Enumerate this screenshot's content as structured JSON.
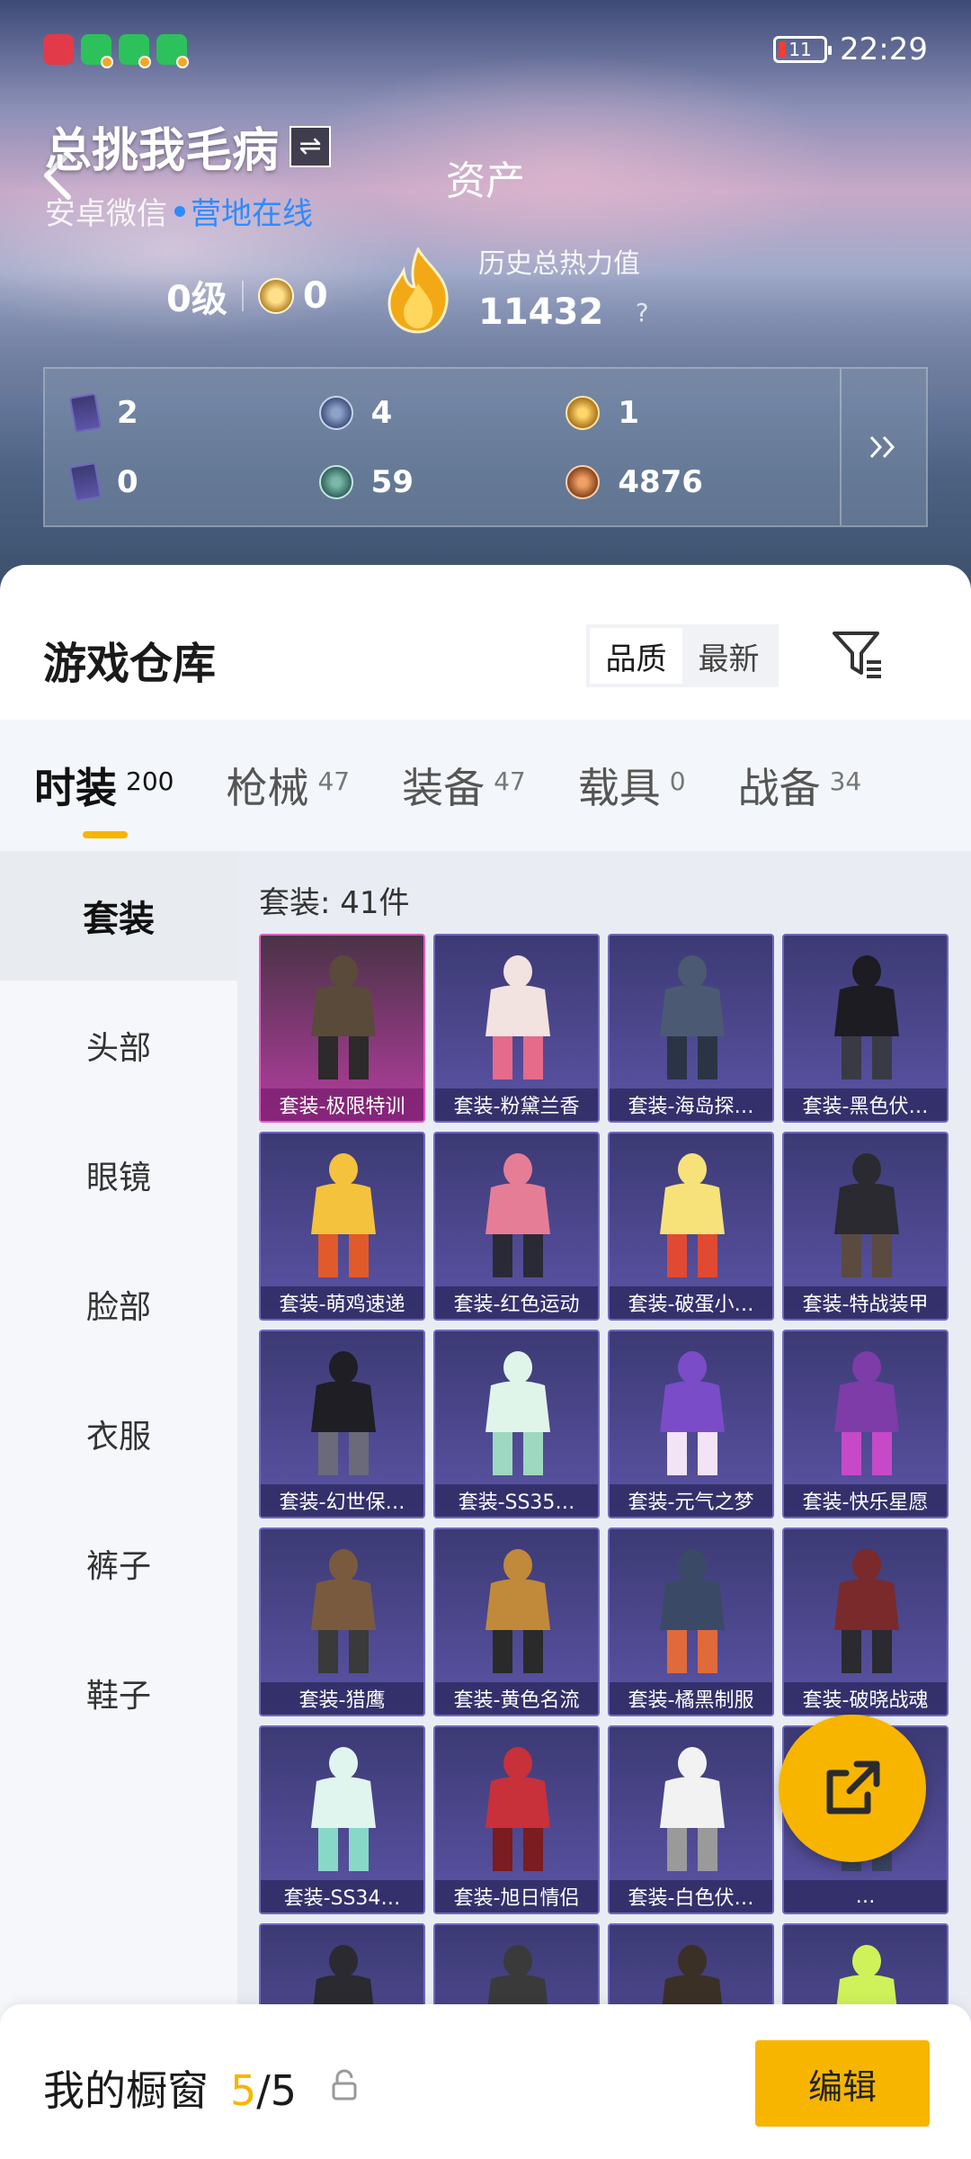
{
  "status_bar": {
    "time": "22:29",
    "battery": "11",
    "notifications": [
      "notification-app-icon",
      "wechat-icon",
      "wechat-icon",
      "wechat-icon"
    ]
  },
  "header": {
    "page_title": "资产",
    "username": "总挑我毛病",
    "platform": "安卓微信",
    "online_status": "营地在线",
    "level": "0级",
    "rank_value": "0",
    "heat_label": "历史总热力值",
    "heat_value": "11432",
    "help": "?"
  },
  "currencies": [
    {
      "icon": "card-ticket-icon",
      "value": "2"
    },
    {
      "icon": "silver-coin-icon",
      "value": "4"
    },
    {
      "icon": "gold-coin-icon",
      "value": "1"
    },
    {
      "icon": "green-card-icon",
      "value": "0"
    },
    {
      "icon": "teal-coin-icon",
      "value": "59"
    },
    {
      "icon": "copper-coin-icon",
      "value": "4876"
    }
  ],
  "warehouse": {
    "title": "游戏仓库",
    "sort_options": [
      "品质",
      "最新"
    ],
    "active_sort": "品质"
  },
  "category_tabs": [
    {
      "label": "时装",
      "count": "200",
      "active": true
    },
    {
      "label": "枪械",
      "count": "47"
    },
    {
      "label": "装备",
      "count": "47"
    },
    {
      "label": "载具",
      "count": "0"
    },
    {
      "label": "战备",
      "count": "34"
    }
  ],
  "side_menu": [
    "套装",
    "头部",
    "眼镜",
    "脸部",
    "衣服",
    "裤子",
    "鞋子"
  ],
  "set_count_label": "套装: 41件",
  "items": [
    {
      "name": "套装-极限特训",
      "quality": "legendary"
    },
    {
      "name": "套装-粉黛兰香"
    },
    {
      "name": "套装-海岛探…"
    },
    {
      "name": "套装-黑色伏…"
    },
    {
      "name": "套装-萌鸡速递"
    },
    {
      "name": "套装-红色运动"
    },
    {
      "name": "套装-破蛋小…"
    },
    {
      "name": "套装-特战装甲"
    },
    {
      "name": "套装-幻世保…"
    },
    {
      "name": "套装-SS35…"
    },
    {
      "name": "套装-元气之梦"
    },
    {
      "name": "套装-快乐星愿"
    },
    {
      "name": "套装-猎鹰"
    },
    {
      "name": "套装-黄色名流"
    },
    {
      "name": "套装-橘黑制服"
    },
    {
      "name": "套装-破晓战魂"
    },
    {
      "name": "套装-SS34…"
    },
    {
      "name": "套装-旭日情侣"
    },
    {
      "name": "套装-白色伏…"
    },
    {
      "name": "…"
    },
    {
      "name": ""
    },
    {
      "name": ""
    },
    {
      "name": ""
    },
    {
      "name": ""
    }
  ],
  "bottom_bar": {
    "window_label": "我的橱窗",
    "window_current": "5",
    "window_total": "/5",
    "edit_label": "编辑"
  },
  "colors": {
    "accent": "#f7b500",
    "online": "#2f8bff",
    "card_bg": "#4b4590",
    "legendary_card_bg": "#b53ea0"
  }
}
